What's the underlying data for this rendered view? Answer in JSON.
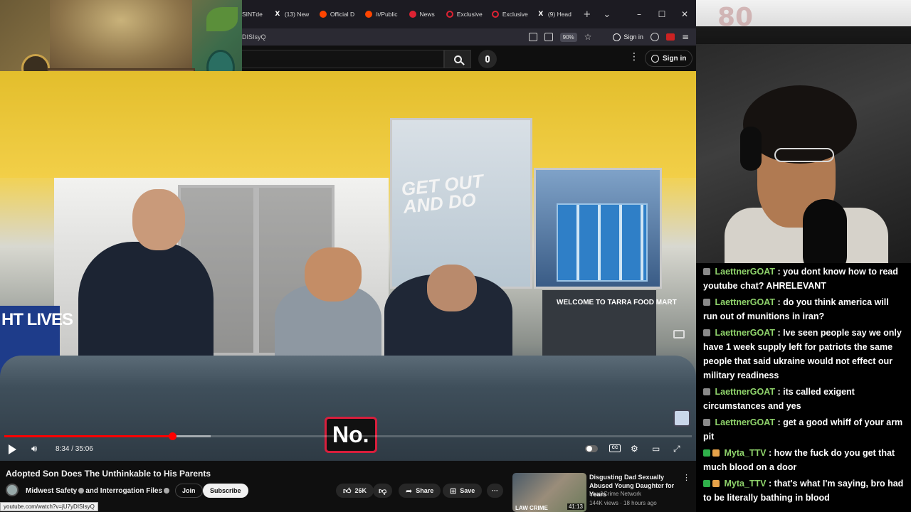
{
  "browser": {
    "tabs": [
      {
        "label": "SINTde",
        "icon": "text"
      },
      {
        "label": "(13) New",
        "icon": "x-logo"
      },
      {
        "label": "Official D",
        "icon": "reddit-logo"
      },
      {
        "label": "/r/Public",
        "icon": "reddit-logo"
      },
      {
        "label": "News",
        "icon": "youtube-logo"
      },
      {
        "label": "Exclusive",
        "icon": "loading-ring"
      },
      {
        "label": "Exclusive",
        "icon": "loading-ring"
      },
      {
        "label": "(9) Head",
        "icon": "x-logo"
      }
    ],
    "new_tab": "+",
    "tab_list": "⌄",
    "url": "DISIsyQ",
    "zoom": "90%",
    "sign_in": "Sign in"
  },
  "youtube": {
    "sign_in": "Sign in"
  },
  "player": {
    "caption": "No.",
    "time": "8:34 / 35:06",
    "progress": 0.244
  },
  "video": {
    "title": "Adopted Son Does The Unthinkable to His Parents",
    "channel": "Midwest Safety",
    "channel_suffix": "and Interrogation Files",
    "join": "Join",
    "subscribe": "Subscribe",
    "likes": "26K",
    "share": "Share",
    "save": "Save",
    "more": "···"
  },
  "status_url": "youtube.com/watch?v=jU7yDISIsyQ",
  "recommended": {
    "title": "Disgusting Dad Sexually Abused Young Daughter for Years",
    "channel": "Law&Crime Network",
    "views": "144K views · 18 hours ago",
    "duration": "41:13",
    "thumb_text": "LAW CRIME"
  },
  "chat": [
    {
      "user": "LaettnerGOAT",
      "text": ": you dont know how to read youtube chat? AHRELEVANT",
      "badges": 1
    },
    {
      "user": "LaettnerGOAT",
      "text": ": do you think america will run out of munitions in iran?",
      "badges": 1
    },
    {
      "user": "LaettnerGOAT",
      "text": ": Ive seen people say we only have 1 week supply left for patriots the same people that said ukraine would not effect our military readiness",
      "badges": 1
    },
    {
      "user": "LaettnerGOAT",
      "text": ": its called exigent circumstances and yes",
      "badges": 1
    },
    {
      "user": "LaettnerGOAT",
      "text": ": get a good whiff of your arm pit",
      "badges": 1
    },
    {
      "user": "Myta_TTV",
      "text": ": how the fuck do you get that much blood on a door",
      "badges": 2
    },
    {
      "user": "Myta_TTV",
      "text": ": that's what I'm saying, bro had to be literally bathing in blood",
      "badges": 2
    }
  ],
  "colors": {
    "accent": "#ff0000",
    "chat_user": "#8fd36b",
    "caption_border": "#d81e3c"
  }
}
